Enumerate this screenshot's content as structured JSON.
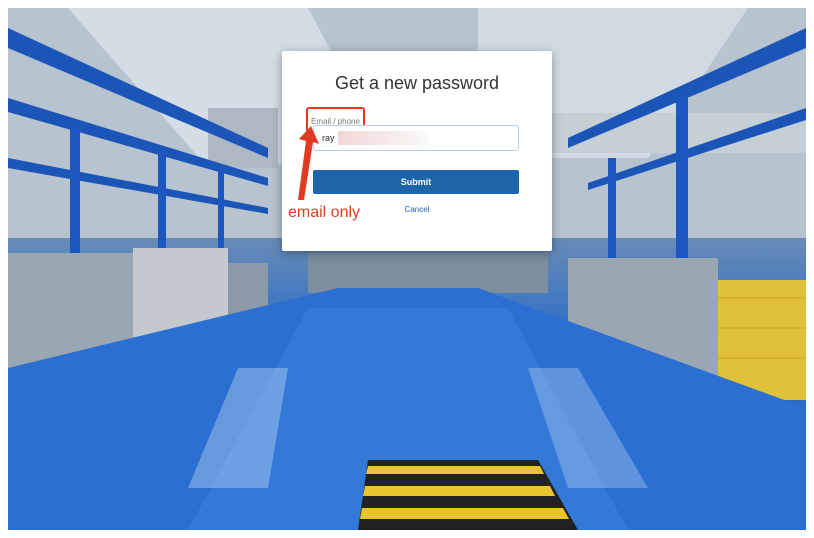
{
  "dialog": {
    "title": "Get a new password",
    "field_label": "Email / phone",
    "email_value": "ray",
    "submit_label": "Submit",
    "cancel_label": "Cancel"
  },
  "annotation": {
    "text": "email only",
    "color": "#e23a22"
  },
  "colors": {
    "primary": "#1d65a8",
    "floor": "#2a6fd1"
  }
}
